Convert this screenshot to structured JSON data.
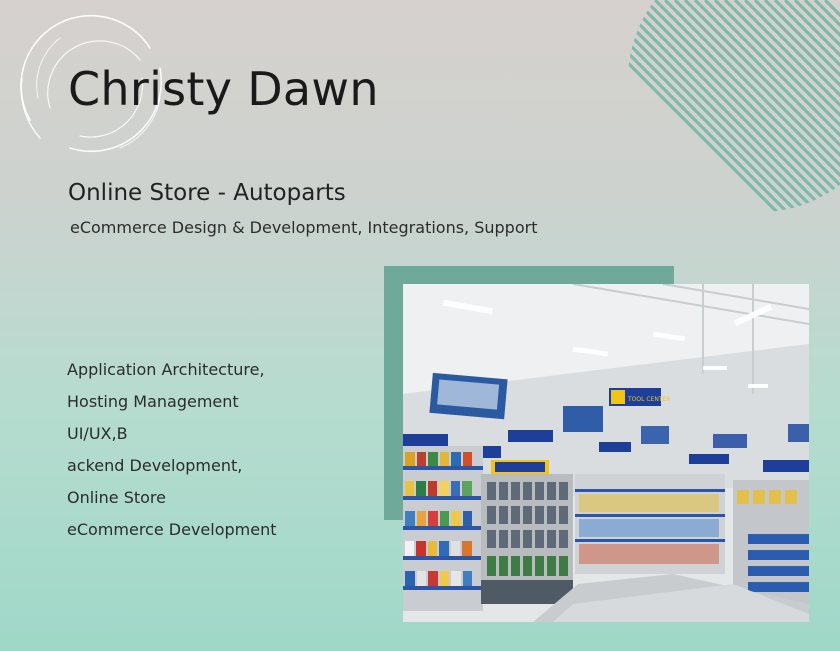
{
  "client": {
    "name": "Christy Dawn"
  },
  "project": {
    "title": "Online Store - Autoparts",
    "services": "eCommerce Design & Development, Integrations, Support"
  },
  "technologies": [
    "Application Architecture,",
    "Hosting Management",
    "UI/UX,B",
    "ackend Development,",
    "Online Store",
    "eCommerce Development"
  ],
  "photo": {
    "sign_text": "TOOL CENTER"
  },
  "colors": {
    "accent_teal": "#6fa99a",
    "stripes": "#7fb9a9",
    "text": "#1f1f1f",
    "store_blue": "#1d3f9a",
    "store_yellow": "#f2c418"
  },
  "icons": [
    "circle-arcs-decoration",
    "diagonal-stripes-decoration"
  ]
}
